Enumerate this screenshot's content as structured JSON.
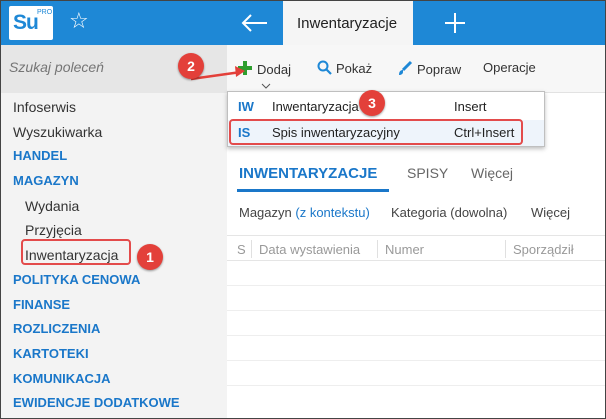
{
  "app": {
    "logo_text": "Su",
    "logo_sup": "PRO",
    "colors": {
      "topbar": "#1e88d6",
      "accent": "#1a77c9",
      "annotation": "#e3403a"
    }
  },
  "header": {
    "active_tab": "Inwentaryzacje",
    "icons": [
      "star-icon",
      "back-arrow-icon",
      "plus-icon"
    ]
  },
  "sidebar": {
    "search_placeholder": "Szukaj poleceń",
    "items": [
      {
        "label": "Infoserwis",
        "type": "item"
      },
      {
        "label": "Wyszukiwarka",
        "type": "item"
      },
      {
        "label": "HANDEL",
        "type": "section"
      },
      {
        "label": "MAGAZYN",
        "type": "section"
      },
      {
        "label": "Wydania",
        "type": "sub"
      },
      {
        "label": "Przyjęcia",
        "type": "sub"
      },
      {
        "label": "Inwentaryzacja",
        "type": "sub"
      },
      {
        "label": "POLITYKA CENOWA",
        "type": "section"
      },
      {
        "label": "FINANSE",
        "type": "section"
      },
      {
        "label": "ROZLICZENIA",
        "type": "section"
      },
      {
        "label": "KARTOTEKI",
        "type": "section"
      },
      {
        "label": "KOMUNIKACJA",
        "type": "section"
      },
      {
        "label": "EWIDENCJE DODATKOWE",
        "type": "section"
      }
    ]
  },
  "toolbar": {
    "add_label": "Dodaj",
    "show_label": "Pokaż",
    "edit_label": "Popraw",
    "operations_label": "Operacje"
  },
  "dropdown": {
    "items": [
      {
        "code": "IW",
        "label": "Inwentaryzacja",
        "shortcut": "Insert"
      },
      {
        "code": "IS",
        "label": "Spis inwentaryzacyjny",
        "shortcut": "Ctrl+Insert"
      }
    ]
  },
  "content": {
    "tabs": [
      "INWENTARYZACJE",
      "SPISY",
      "Więcej"
    ],
    "filters": {
      "magazyn_label": "Magazyn",
      "magazyn_value": "(z kontekstu)",
      "kategoria": "Kategoria (dowolna)",
      "more": "Więcej"
    },
    "columns": [
      "S",
      "Data wystawienia",
      "Numer",
      "Sporządził"
    ]
  },
  "annotations": [
    "1",
    "2",
    "3"
  ]
}
